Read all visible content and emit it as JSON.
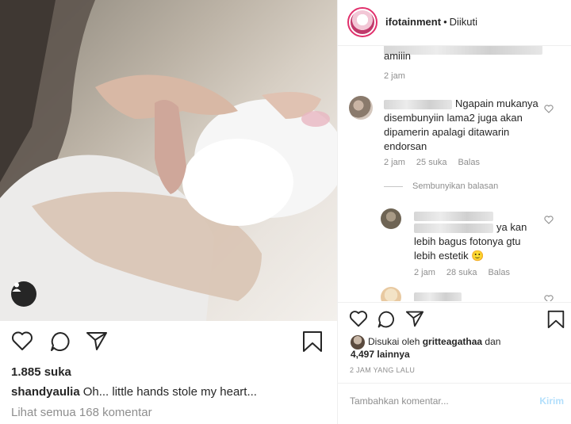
{
  "post": {
    "likes": "1.885 suka",
    "username": "shandyaulia",
    "caption": "Oh... little hands stole my heart...",
    "view_all_comments": "Lihat semua 168 komentar"
  },
  "panel": {
    "account_name": "ifotainment",
    "follow_status": "Diikuti",
    "comments": [
      {
        "text": "amiiin",
        "time": "2 jam"
      },
      {
        "text": "Ngapain mukanya disembunyiin lama2 juga akan dipamerin apalagi ditawarin endorsan",
        "time": "2 jam",
        "likes": "25 suka",
        "reply": "Balas"
      },
      {
        "text": "ya kan lebih bagus fotonya gtu lebih estetik 🙂",
        "time": "2 jam",
        "likes": "28 suka",
        "reply": "Balas"
      }
    ],
    "hide_replies": "Sembunyikan balasan",
    "liked_by_prefix": "Disukai oleh",
    "liked_by_user": "gritteagathaa",
    "liked_by_conj": "dan",
    "liked_by_others": "4,497 lainnya",
    "time_ago": "2 JAM YANG LALU",
    "add_comment_placeholder": "Tambahkan komentar...",
    "post_button": "Kirim"
  },
  "icons": [
    "heart-icon",
    "comment-icon",
    "share-icon",
    "bookmark-icon",
    "user-tag-icon"
  ],
  "colors": {
    "link_muted": "#8e8e8e",
    "post_button_disabled": "#b2dffc",
    "text": "#262626"
  }
}
